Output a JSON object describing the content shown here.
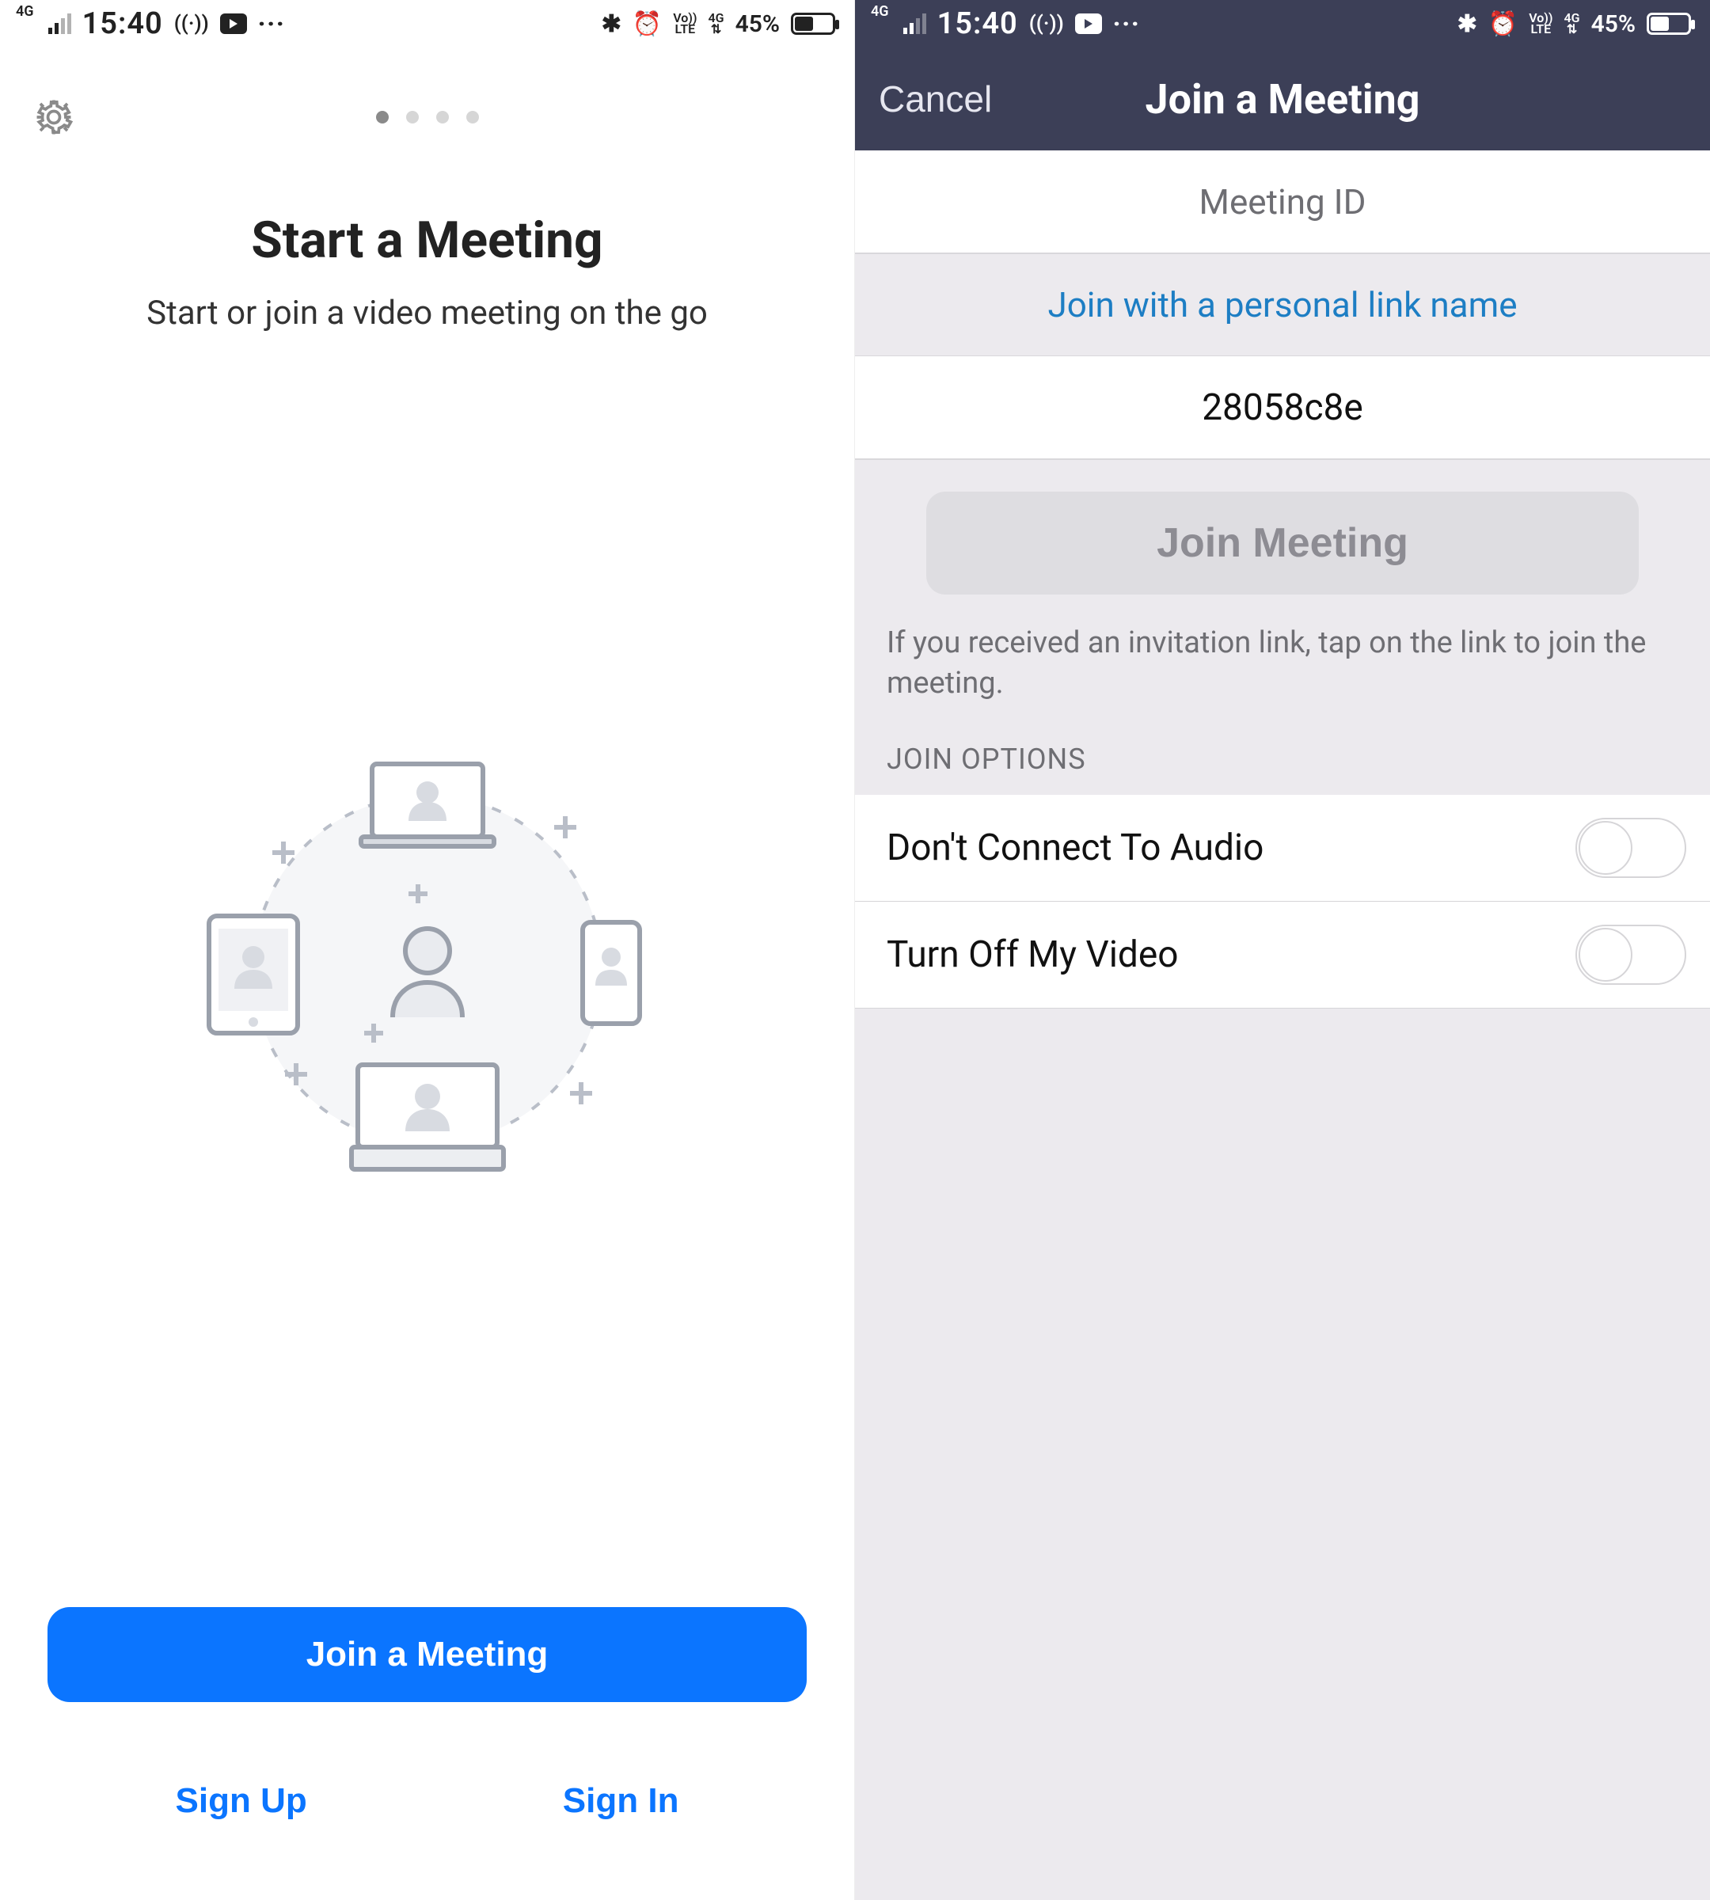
{
  "status_bar": {
    "network_type": "4G",
    "time": "15:40",
    "lte_label": "Vo))\nLTE",
    "net_label_4g": "4G",
    "battery_pct": "45%"
  },
  "left": {
    "title": "Start a Meeting",
    "subtitle": "Start or join a video meeting on the go",
    "join_button": "Join a Meeting",
    "sign_up": "Sign Up",
    "sign_in": "Sign In",
    "page_index": 0,
    "page_count": 4
  },
  "right": {
    "cancel": "Cancel",
    "title": "Join a Meeting",
    "meeting_id_placeholder": "Meeting ID",
    "personal_link": "Join with a personal link name",
    "display_name": "28058c8e",
    "join_button": "Join Meeting",
    "hint": "If you received an invitation link, tap on the link to join the meeting.",
    "options_label": "JOIN OPTIONS",
    "option_audio": "Don't Connect To Audio",
    "option_video": "Turn Off My Video",
    "option_audio_on": false,
    "option_video_on": false
  }
}
